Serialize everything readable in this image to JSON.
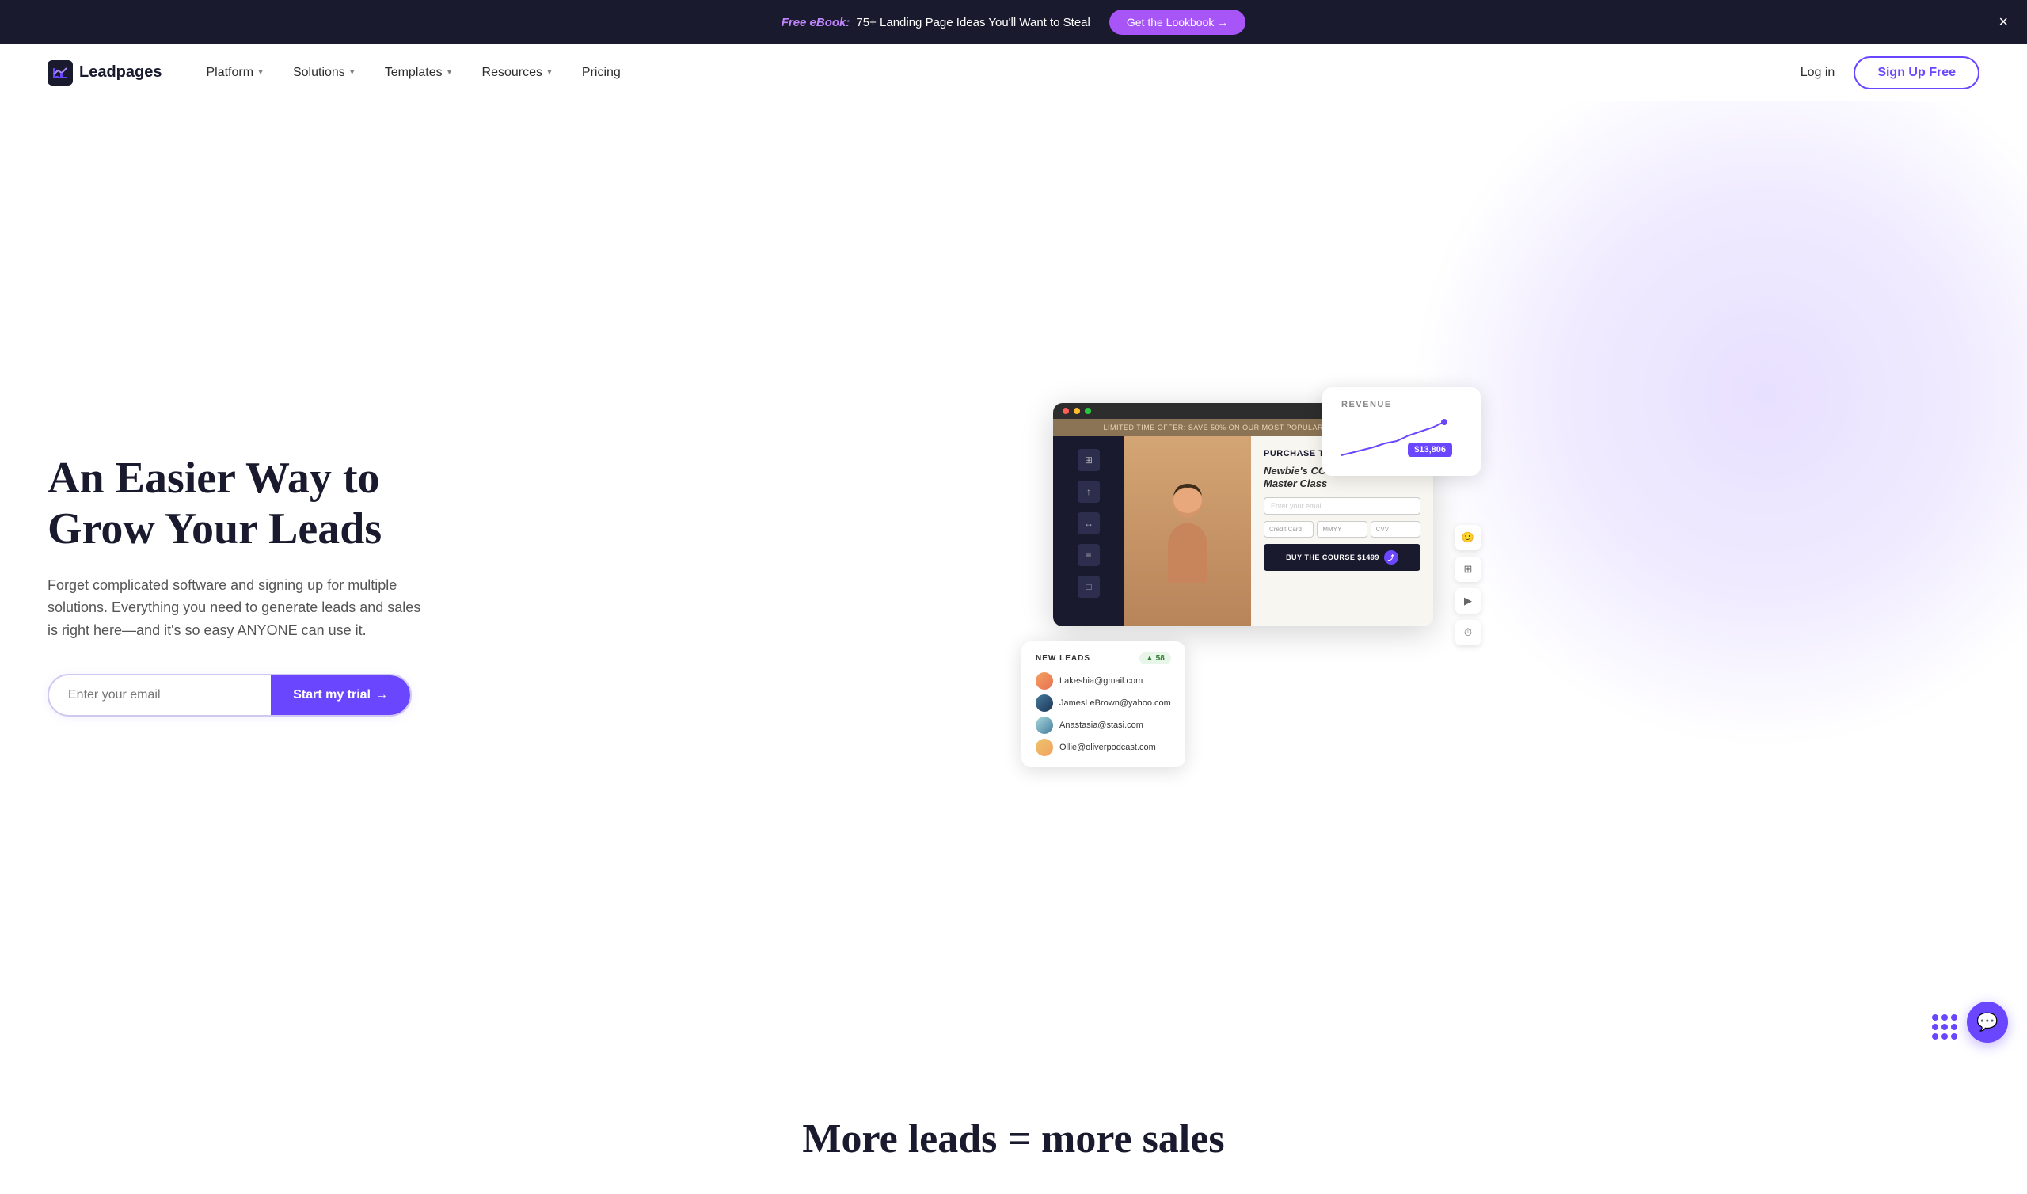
{
  "announcement": {
    "ebook_label": "Free eBook:",
    "ebook_text": " 75+ Landing Page Ideas You'll Want to Steal",
    "cta_label": "Get the Lookbook →",
    "close_label": "×"
  },
  "nav": {
    "logo_text": "Leadpages",
    "platform_label": "Platform",
    "solutions_label": "Solutions",
    "templates_label": "Templates",
    "resources_label": "Resources",
    "pricing_label": "Pricing",
    "login_label": "Log in",
    "signup_label": "Sign Up Free"
  },
  "hero": {
    "title": "An Easier Way to Grow Your Leads",
    "subtitle": "Forget complicated software and signing up for multiple solutions. Everything you need to generate leads and sales is right here—and it's so easy ANYONE can use it.",
    "email_placeholder": "Enter your email",
    "cta_label": "Start my trial",
    "cta_arrow": "→"
  },
  "mockup": {
    "banner_text": "LIMITED TIME OFFER: SAVE 50% ON OUR MOST POPULAR MASTERCLASS",
    "form_title": "PURCHASE THE",
    "form_subtitle": "Newbie's CONTENT CREATION Master Class",
    "email_placeholder": "Enter your email",
    "cc_placeholder": "Credit Card",
    "mm_placeholder": "MMYY",
    "cvv_placeholder": "CVV",
    "buy_btn": "BUY THE COURSE $1499"
  },
  "revenue_card": {
    "label": "REVENUE",
    "amount": "$13,806"
  },
  "leads_card": {
    "title": "NEW LEADS",
    "badge": "▲ 58",
    "leads": [
      {
        "email": "Lakeshia@gmail.com"
      },
      {
        "email": "JamesLeBrown@yahoo.com"
      },
      {
        "email": "Anastasia@stasi.com"
      },
      {
        "email": "Ollie@oliverpodcast.com"
      }
    ]
  },
  "bottom": {
    "title": "More leads = more sales"
  },
  "chat": {
    "icon": "💬"
  }
}
